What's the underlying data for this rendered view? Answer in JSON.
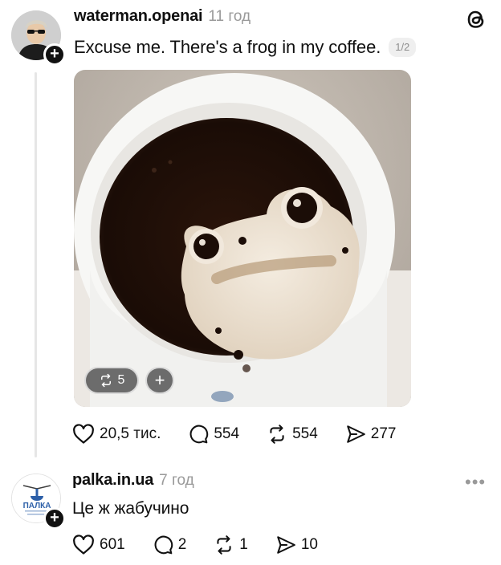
{
  "post": {
    "username": "waterman.openai",
    "time": "11 год",
    "text": "Excuse me. There's a frog in my coffee.",
    "page_indicator": "1/2",
    "image_alt": "Cup of coffee with foam shaped like a frog",
    "repost_chip_count": "5",
    "actions": {
      "likes": "20,5 тис.",
      "replies": "554",
      "reposts": "554",
      "shares": "277"
    }
  },
  "reply": {
    "username": "palka.in.ua",
    "time": "7 год",
    "text": "Це ж жабучино",
    "avatar_text": "ПАЛКА",
    "actions": {
      "likes": "601",
      "replies": "2",
      "reposts": "1",
      "shares": "10"
    }
  },
  "icons": {
    "app_logo": "threads-logo-icon",
    "like": "heart-icon",
    "reply": "speech-bubble-icon",
    "repost": "repost-icon",
    "share": "send-icon",
    "more": "more-dots-icon"
  },
  "colors": {
    "text": "#101010",
    "muted": "#9a9a9a",
    "thread_line": "#e6e6e6"
  }
}
